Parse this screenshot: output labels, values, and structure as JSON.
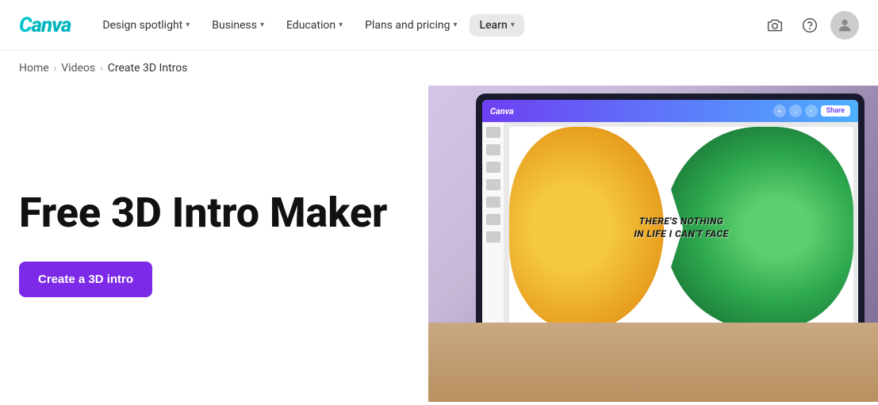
{
  "nav": {
    "logo": "Canva",
    "items": [
      {
        "id": "design-spotlight",
        "label": "Design spotlight",
        "hasChevron": true
      },
      {
        "id": "business",
        "label": "Business",
        "hasChevron": true
      },
      {
        "id": "education",
        "label": "Education",
        "hasChevron": true
      },
      {
        "id": "plans-pricing",
        "label": "Plans and pricing",
        "hasChevron": true
      },
      {
        "id": "learn",
        "label": "Learn",
        "hasChevron": true,
        "active": true
      }
    ],
    "icons": {
      "camera": "⊙",
      "help": "?",
      "avatar": "👤"
    }
  },
  "breadcrumb": {
    "items": [
      {
        "label": "Home",
        "href": "#"
      },
      {
        "label": "Videos",
        "href": "#"
      },
      {
        "label": "Create 3D Intros",
        "current": true
      }
    ]
  },
  "hero": {
    "title": "Free 3D Intro Maker",
    "cta_label": "Create a 3D intro"
  },
  "editor": {
    "logo": "Canva",
    "share_label": "Share",
    "design_text_line1": "THERE'S NOTHING",
    "design_text_line2": "IN LIFE I CAN'T FACE"
  }
}
